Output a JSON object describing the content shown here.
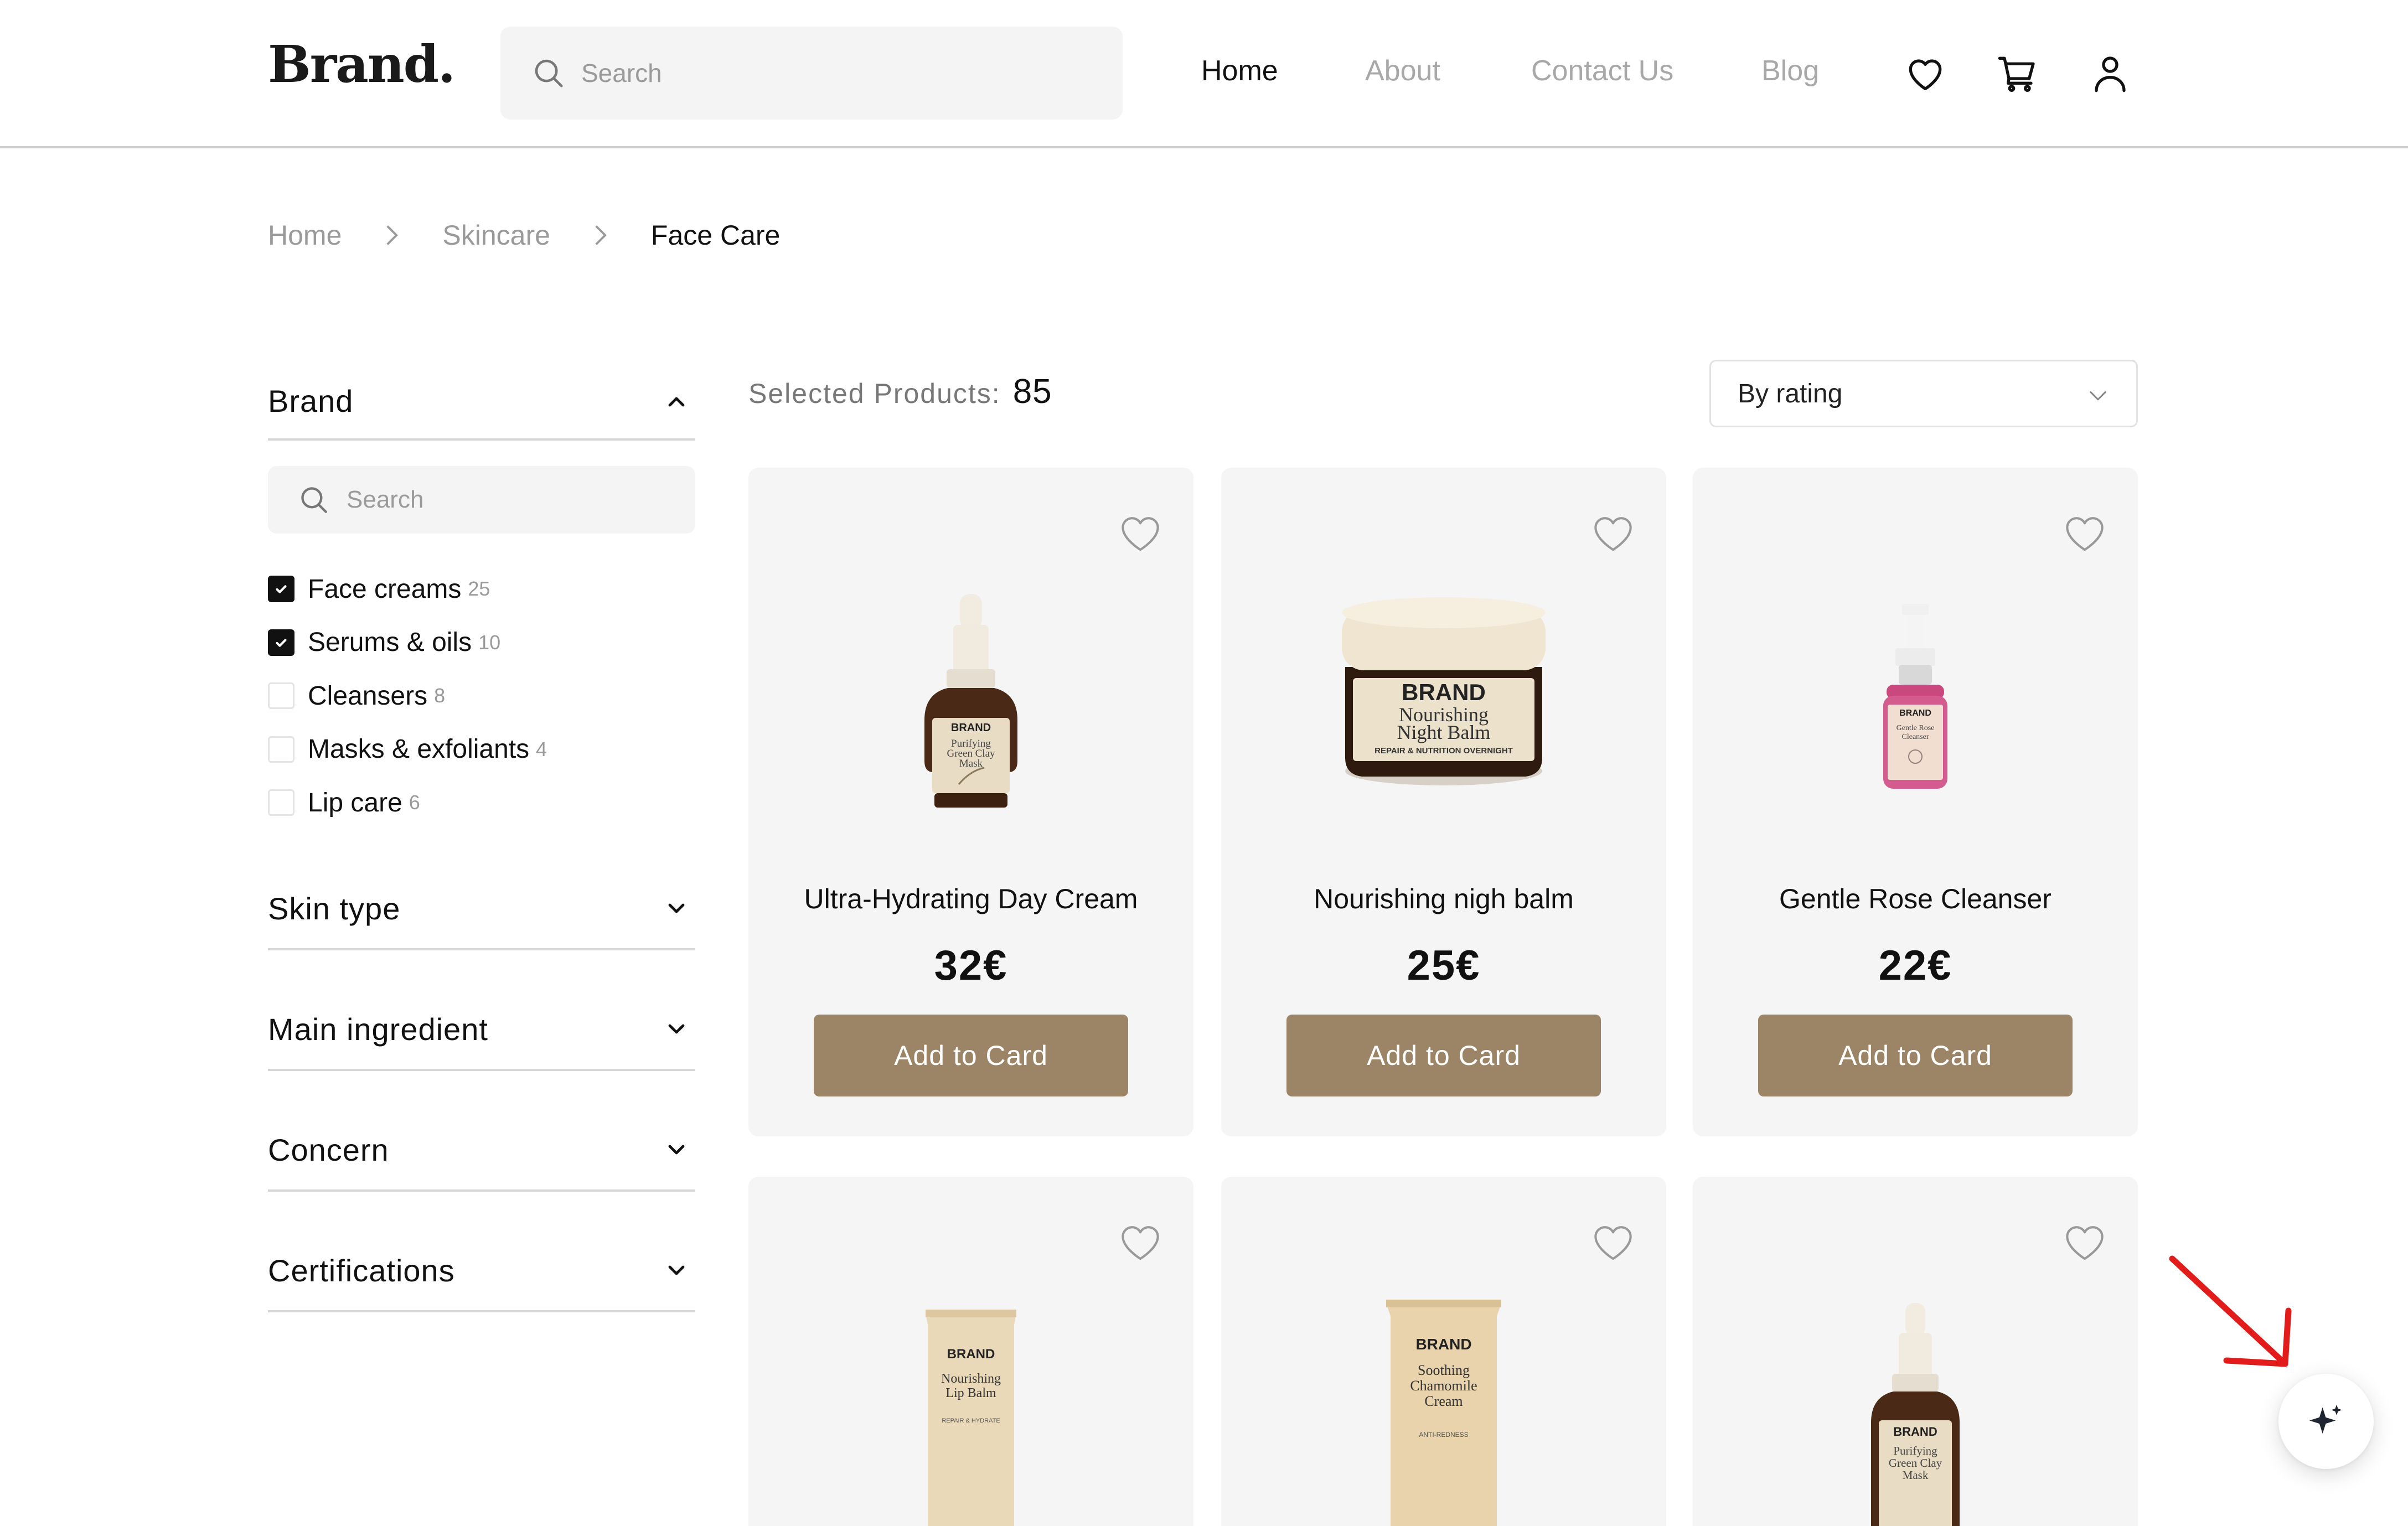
{
  "header": {
    "logo": "Brand.",
    "search_placeholder": "Search",
    "nav": [
      {
        "label": "Home",
        "active": true
      },
      {
        "label": "About",
        "active": false
      },
      {
        "label": "Contact Us",
        "active": false
      },
      {
        "label": "Blog",
        "active": false
      }
    ],
    "icons": [
      "heart-icon",
      "cart-icon",
      "user-icon"
    ]
  },
  "breadcrumb": [
    "Home",
    "Skincare",
    "Face Care"
  ],
  "sidebar": {
    "brand_filter": {
      "title": "Brand",
      "expanded": true,
      "search_placeholder": "Search",
      "options": [
        {
          "label": "Face creams",
          "count": "25",
          "checked": true
        },
        {
          "label": "Serums & oils",
          "count": "10",
          "checked": true
        },
        {
          "label": "Cleansers",
          "count": "8",
          "checked": false
        },
        {
          "label": "Masks & exfoliants",
          "count": "4",
          "checked": false
        },
        {
          "label": "Lip care",
          "count": "6",
          "checked": false
        }
      ]
    },
    "collapsed_filters": [
      "Skin type",
      "Main ingredient",
      "Concern",
      "Certifications"
    ]
  },
  "toolbar": {
    "selected_label": "Selected Products:",
    "selected_count": "85",
    "sort_value": "By rating"
  },
  "products": [
    {
      "name": "Ultra-Hydrating Day Cream",
      "price": "32€",
      "button": "Add to Card",
      "image": {
        "kind": "dropper",
        "brand": "BRAND",
        "lines": [
          "Purifying",
          "Green Clay",
          "Mask"
        ]
      }
    },
    {
      "name": "Nourishing nigh balm",
      "price": "25€",
      "button": "Add to Card",
      "image": {
        "kind": "jar",
        "brand": "BRAND",
        "lines": [
          "Nourishing",
          "Night Balm"
        ],
        "sub": "REPAIR & NUTRITION OVERNIGHT"
      }
    },
    {
      "name": "Gentle Rose Cleanser",
      "price": "22€",
      "button": "Add to Card",
      "image": {
        "kind": "spray",
        "brand": "BRAND",
        "lines": [
          "Gentle Rose",
          "Cleanser"
        ]
      }
    },
    {
      "image": {
        "kind": "tube",
        "brand": "BRAND",
        "lines": [
          "Nourishing",
          "Lip Balm"
        ],
        "sub": "REPAIR & HYDRATE"
      }
    },
    {
      "image": {
        "kind": "tube",
        "brand": "BRAND",
        "lines": [
          "Soothing",
          "Chamomile",
          "Cream"
        ],
        "sub": "ANTI-REDNESS"
      }
    },
    {
      "image": {
        "kind": "dropper",
        "brand": "BRAND",
        "lines": [
          "Purifying",
          "Green Clay",
          "Mask"
        ]
      }
    }
  ],
  "colors": {
    "button": "#9c8567",
    "card_bg": "#f5f5f5",
    "annotation_arrow": "#e21b1b"
  }
}
